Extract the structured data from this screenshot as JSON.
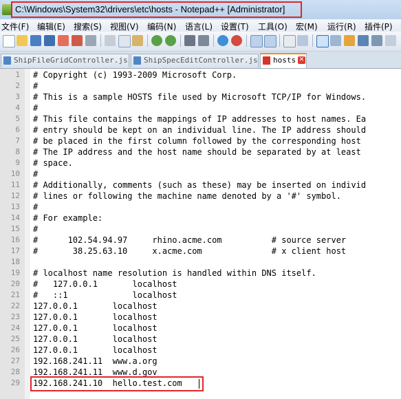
{
  "window": {
    "title": "C:\\Windows\\System32\\drivers\\etc\\hosts - Notepad++ [Administrator]"
  },
  "menu": [
    "文件(F)",
    "编辑(E)",
    "搜索(S)",
    "视图(V)",
    "编码(N)",
    "语言(L)",
    "设置(T)",
    "工具(O)",
    "宏(M)",
    "运行(R)",
    "插件(P)"
  ],
  "toolbar_icons": [
    "new-file-icon",
    "open-file-icon",
    "save-icon",
    "save-all-icon",
    "close-icon",
    "close-all-icon",
    "print-icon",
    "cut-icon",
    "copy-icon",
    "paste-icon",
    "undo-icon",
    "redo-icon",
    "find-icon",
    "replace-icon",
    "zoom-in-icon",
    "zoom-out-icon",
    "sync-vertical-icon",
    "sync-horizontal-icon",
    "word-wrap-icon",
    "show-all-chars-icon",
    "indent-guide-icon",
    "doc-map-icon",
    "function-list-icon",
    "folder-workspace-icon",
    "monitor-icon"
  ],
  "tabs": [
    {
      "label": "ShipFileGridController.js",
      "active": false,
      "icon_color": "#4f86c6"
    },
    {
      "label": "ShipSpecEditController.js",
      "active": false,
      "icon_color": "#4f86c6"
    },
    {
      "label": "hosts",
      "active": true,
      "icon_color": "#d9342b"
    }
  ],
  "lines": [
    {
      "n": "1",
      "text": "# Copyright (c) 1993-2009 Microsoft Corp."
    },
    {
      "n": "2",
      "text": "#"
    },
    {
      "n": "3",
      "text": "# This is a sample HOSTS file used by Microsoft TCP/IP for Windows."
    },
    {
      "n": "4",
      "text": "#"
    },
    {
      "n": "5",
      "text": "# This file contains the mappings of IP addresses to host names. Ea"
    },
    {
      "n": "6",
      "text": "# entry should be kept on an individual line. The IP address should"
    },
    {
      "n": "7",
      "text": "# be placed in the first column followed by the corresponding host"
    },
    {
      "n": "8",
      "text": "# The IP address and the host name should be separated by at least"
    },
    {
      "n": "9",
      "text": "# space."
    },
    {
      "n": "10",
      "text": "#"
    },
    {
      "n": "11",
      "text": "# Additionally, comments (such as these) may be inserted on individ"
    },
    {
      "n": "12",
      "text": "# lines or following the machine name denoted by a '#' symbol."
    },
    {
      "n": "13",
      "text": "#"
    },
    {
      "n": "14",
      "text": "# For example:"
    },
    {
      "n": "15",
      "text": "#"
    },
    {
      "n": "16",
      "text": "#      102.54.94.97     rhino.acme.com          # source server"
    },
    {
      "n": "17",
      "text": "#       38.25.63.10     x.acme.com              # x client host"
    },
    {
      "n": "18",
      "text": ""
    },
    {
      "n": "19",
      "text": "# localhost name resolution is handled within DNS itself."
    },
    {
      "n": "20",
      "text": "#   127.0.0.1       localhost"
    },
    {
      "n": "21",
      "text": "#   ::1             localhost"
    },
    {
      "n": "22",
      "text": "127.0.0.1       localhost"
    },
    {
      "n": "23",
      "text": "127.0.0.1       localhost"
    },
    {
      "n": "24",
      "text": "127.0.0.1       localhost"
    },
    {
      "n": "25",
      "text": "127.0.0.1       localhost"
    },
    {
      "n": "26",
      "text": "127.0.0.1       localhost"
    },
    {
      "n": "27",
      "text": "192.168.241.11  www.a.org"
    },
    {
      "n": "28",
      "text": "192.168.241.11  www.d.gov"
    },
    {
      "n": "29",
      "text": "192.168.241.10  hello.test.com"
    }
  ],
  "colors": {
    "highlight_box": "#e0252b",
    "active_tab_accent": "#f08a24"
  }
}
